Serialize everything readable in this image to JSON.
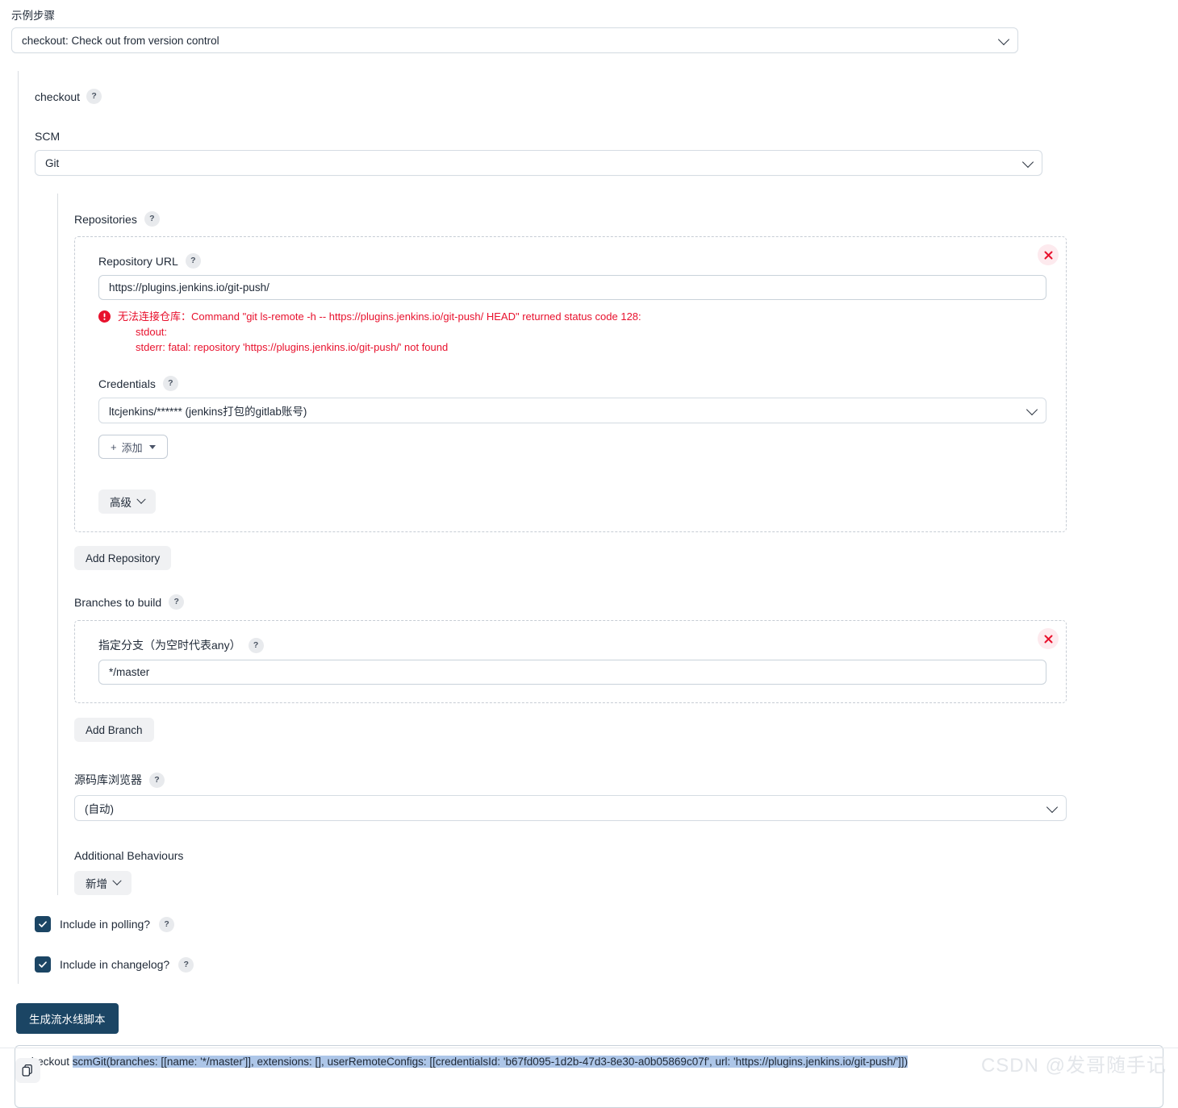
{
  "sample_step": {
    "label": "示例步骤",
    "selected": "checkout: Check out from version control",
    "chevron_icon": "chevron-down-icon"
  },
  "step": {
    "name": "checkout",
    "help": "?"
  },
  "scm": {
    "label": "SCM",
    "selected": "Git",
    "chevron_icon": "chevron-down-icon"
  },
  "repositories": {
    "label": "Repositories",
    "help": "?",
    "delete_icon": "close-icon",
    "repository_url": {
      "label": "Repository URL",
      "help": "?",
      "value": "https://plugins.jenkins.io/git-push/"
    },
    "error": {
      "icon": "error-icon",
      "line1": "无法连接仓库：Command \"git ls-remote -h -- https://plugins.jenkins.io/git-push/ HEAD\" returned status code 128:",
      "line2": "stdout:",
      "line3": "stderr: fatal: repository 'https://plugins.jenkins.io/git-push/' not found",
      "color": "#e8112d"
    },
    "credentials": {
      "label": "Credentials",
      "help": "?",
      "selected": "ltcjenkins/****** (jenkins打包的gitlab账号)",
      "chevron_icon": "chevron-down-icon",
      "add_button": "添加",
      "add_plus": "+",
      "add_caret_icon": "caret-down-icon"
    },
    "advanced_button": "高级",
    "advanced_chevron_icon": "chevron-down-icon",
    "add_repository_button": "Add Repository"
  },
  "branches": {
    "label": "Branches to build",
    "help": "?",
    "delete_icon": "close-icon",
    "branch_field": {
      "label": "指定分支（为空时代表any）",
      "help": "?",
      "value": "*/master"
    },
    "add_branch_button": "Add Branch"
  },
  "repo_browser": {
    "label": "源码库浏览器",
    "help": "?",
    "selected": "(自动)",
    "chevron_icon": "chevron-down-icon"
  },
  "additional_behaviours": {
    "label": "Additional Behaviours",
    "add_button": "新增",
    "chevron_icon": "chevron-down-icon"
  },
  "options": {
    "polling": {
      "label": "Include in polling?",
      "help": "?",
      "checked": true
    },
    "changelog": {
      "label": "Include in changelog?",
      "help": "?",
      "checked": true
    },
    "check_icon": "check-icon"
  },
  "generate": {
    "button_label": "生成流水线脚本"
  },
  "output": {
    "prefix": "checkout ",
    "script": "scmGit(branches: [[name: '*/master']], extensions: [], userRemoteConfigs: [[credentialsId: 'b67fd095-1d2b-47d3-8e30-a0b05869c07f', url: 'https://plugins.jenkins.io/git-push/']])",
    "selection_color": "#adc6e8"
  },
  "copy": {
    "icon": "copy-icon"
  },
  "watermark": {
    "text": "CSDN @发哥随手记"
  },
  "colors": {
    "primary": "#1b4564",
    "error": "#e8112d",
    "border": "#c9d2da"
  }
}
